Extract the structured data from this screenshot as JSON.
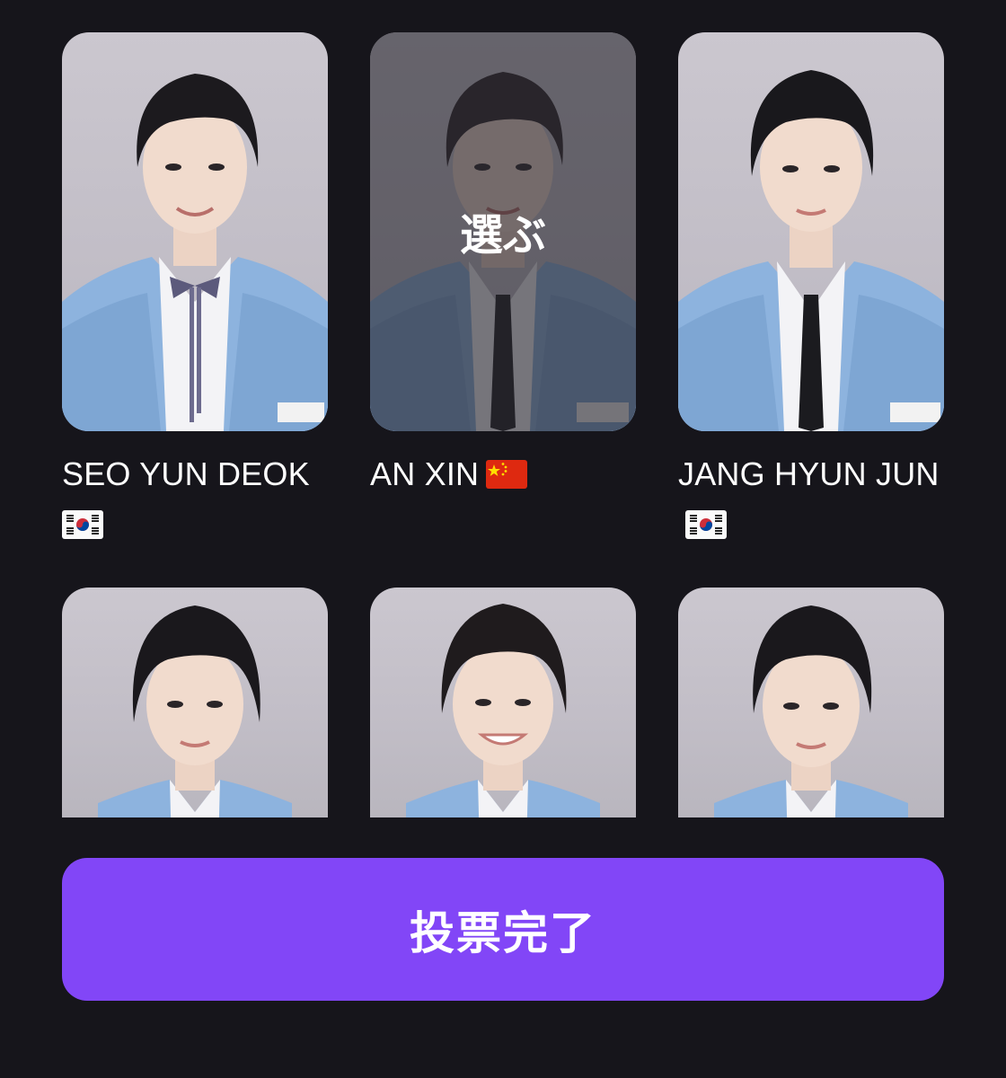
{
  "candidates": [
    {
      "name": "SEO YUN DEOK",
      "flag": "korea-flag-icon",
      "selected": false
    },
    {
      "name": "AN XIN",
      "flag": "china-flag-icon",
      "selected": true,
      "overlay_label": "選ぶ"
    },
    {
      "name": "JANG HYUN JUN",
      "flag": "korea-flag-icon",
      "selected": false
    },
    {
      "name": "",
      "flag": "",
      "selected": false
    },
    {
      "name": "",
      "flag": "",
      "selected": false
    },
    {
      "name": "",
      "flag": "",
      "selected": false
    }
  ],
  "vote_button": {
    "label": "投票完了"
  },
  "colors": {
    "background": "#16151b",
    "accent": "#8246f7",
    "jacket": "#88aedb"
  }
}
